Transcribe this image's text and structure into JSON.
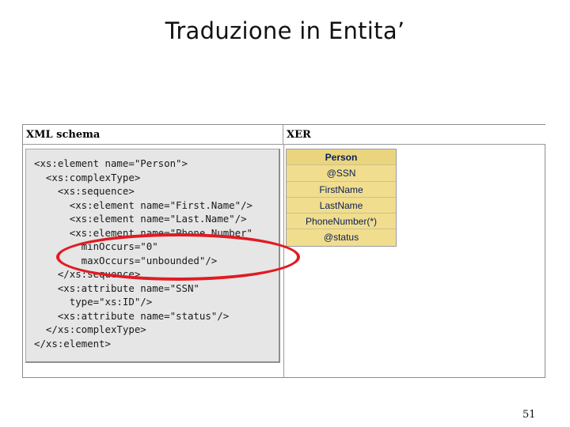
{
  "slide": {
    "title": "Traduzione in Entita’",
    "page_number": "51"
  },
  "figure": {
    "xml_header": "XML schema",
    "xer_header": "XER",
    "code_lines": [
      "<xs:element name=\"Person\">",
      "  <xs:complexType>",
      "    <xs:sequence>",
      "      <xs:element name=\"First.Name\"/>",
      "      <xs:element name=\"Last.Name\"/>",
      "      <xs:element name=\"Phone.Number\"",
      "        minOccurs=\"0\"",
      "        maxOccurs=\"unbounded\"/>",
      "    </xs:sequence>",
      "    <xs:attribute name=\"SSN\"",
      "      type=\"xs:ID\"/>",
      "    <xs:attribute name=\"status\"/>",
      "  </xs:complexType>",
      "</xs:element>"
    ],
    "xer_rows": [
      "Person",
      "@SSN",
      "FirstName",
      "LastName",
      "PhoneNumber(*)",
      "@status"
    ]
  },
  "colors": {
    "highlight_ellipse": "#e11b22",
    "xer_cell_bg": "#f0dd8e",
    "xer_text": "#0a1e58",
    "code_bg": "#e6e6e6"
  }
}
